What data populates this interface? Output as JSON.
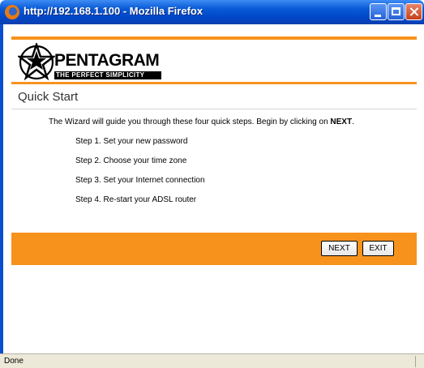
{
  "window": {
    "title": "http://192.168.1.100 - Mozilla Firefox",
    "colors": {
      "titlebar": "#0a5bd8",
      "close": "#c3401c"
    }
  },
  "brand": {
    "logo_name": "PENTAGRAM",
    "logo_tagline": "THE PERFECT SIMPLICITY",
    "accent_color": "#f7931d"
  },
  "page": {
    "title": "Quick Start",
    "intro_text": "The Wizard will guide you through these four quick steps. Begin by clicking on ",
    "intro_emphasis": "NEXT",
    "intro_end": ".",
    "steps": [
      "Step 1. Set your new password",
      "Step 2. Choose your time zone",
      "Step 3. Set your Internet connection",
      "Step 4. Re-start your ADSL router"
    ]
  },
  "buttons": {
    "next": "NEXT",
    "exit": "EXIT"
  },
  "status": {
    "text": "Done"
  },
  "icons": [
    "firefox-icon",
    "minimize-icon",
    "maximize-icon",
    "close-icon",
    "pentagram-star-logo"
  ]
}
